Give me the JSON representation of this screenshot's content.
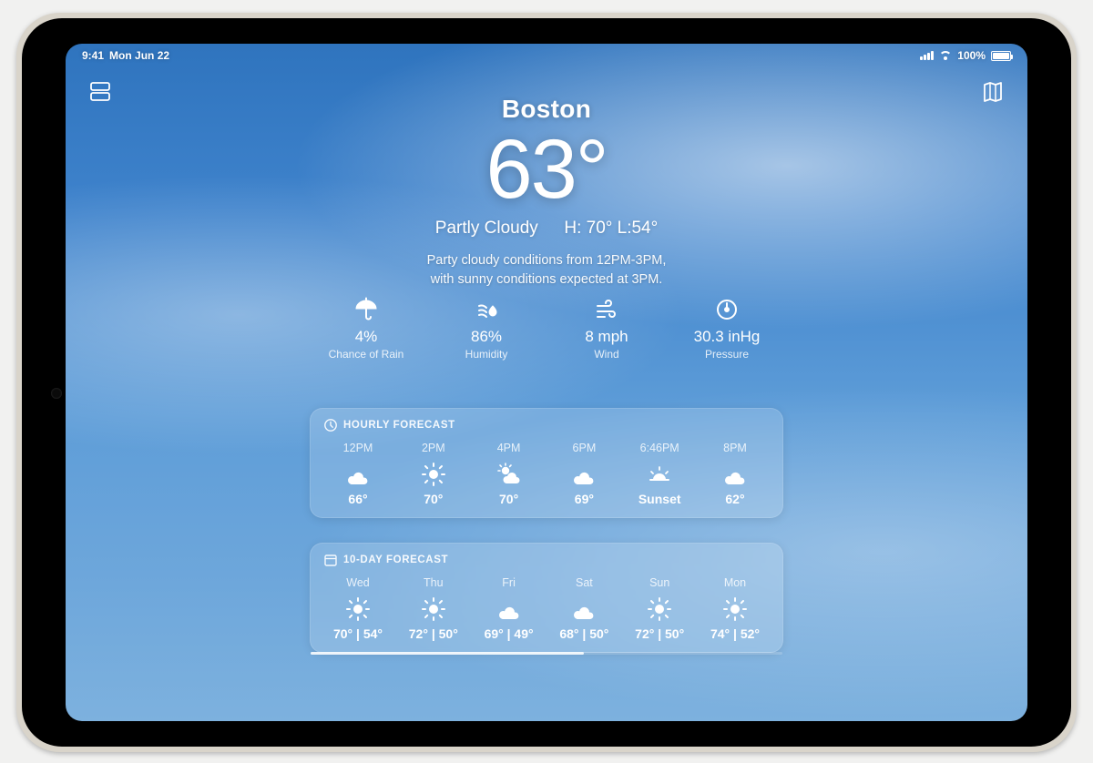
{
  "status": {
    "time": "9:41",
    "date": "Mon Jun 22",
    "battery_pct": "100%"
  },
  "hero": {
    "city": "Boston",
    "temp": "63°",
    "condition": "Partly Cloudy",
    "hi_lo": "H: 70° L:54°",
    "summary_l1": "Party cloudy conditions from 12PM-3PM,",
    "summary_l2": "with sunny conditions expected at 3PM."
  },
  "metrics": [
    {
      "icon": "umbrella",
      "value": "4%",
      "label": "Chance of Rain"
    },
    {
      "icon": "humidity",
      "value": "86%",
      "label": "Humidity"
    },
    {
      "icon": "wind",
      "value": "8 mph",
      "label": "Wind"
    },
    {
      "icon": "pressure",
      "value": "30.3 inHg",
      "label": "Pressure"
    }
  ],
  "hourly": {
    "title": "HOURLY FORECAST",
    "items": [
      {
        "time": "12PM",
        "icon": "cloud",
        "value": "66°"
      },
      {
        "time": "2PM",
        "icon": "sun",
        "value": "70°"
      },
      {
        "time": "4PM",
        "icon": "partly",
        "value": "70°"
      },
      {
        "time": "6PM",
        "icon": "cloud",
        "value": "69°"
      },
      {
        "time": "6:46PM",
        "icon": "sunset",
        "value": "Sunset"
      },
      {
        "time": "8PM",
        "icon": "cloud",
        "value": "62°"
      }
    ]
  },
  "daily": {
    "title": "10-DAY FORECAST",
    "items": [
      {
        "day": "Wed",
        "icon": "sun",
        "value": "70° | 54°"
      },
      {
        "day": "Thu",
        "icon": "sun",
        "value": "72° | 50°"
      },
      {
        "day": "Fri",
        "icon": "cloud",
        "value": "69° | 49°"
      },
      {
        "day": "Sat",
        "icon": "cloud",
        "value": "68° | 50°"
      },
      {
        "day": "Sun",
        "icon": "sun",
        "value": "72° | 50°"
      },
      {
        "day": "Mon",
        "icon": "sun",
        "value": "74° | 52°"
      }
    ]
  }
}
